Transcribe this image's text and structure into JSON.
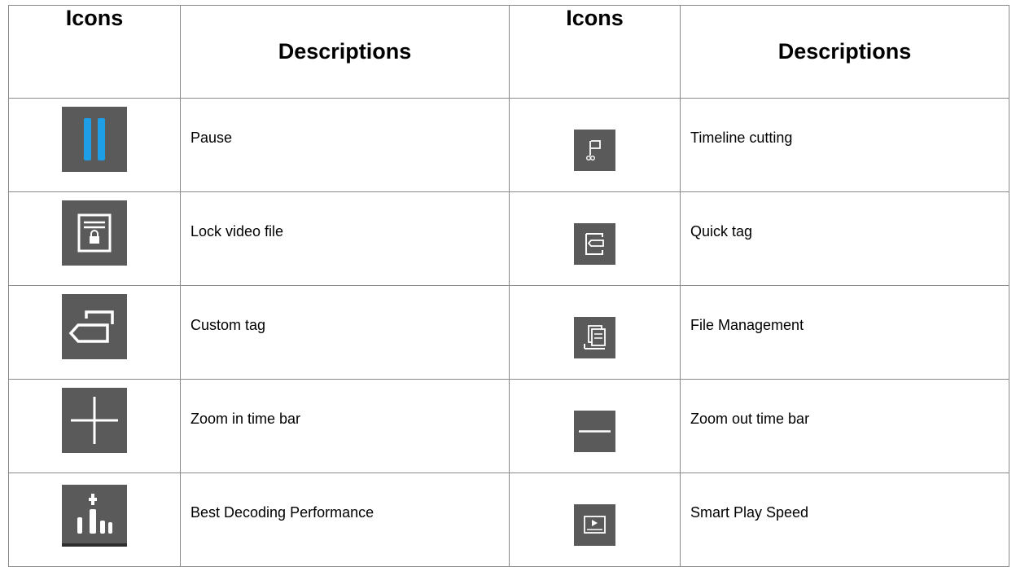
{
  "table": {
    "headers": [
      "Icons",
      "Descriptions",
      "Icons",
      "Descriptions"
    ],
    "rows": [
      {
        "left_icon": "pause-icon",
        "left_label": "Pause",
        "right_icon": "timeline-cutting-icon",
        "right_label": "Timeline cutting"
      },
      {
        "left_icon": "lock-video-file-icon",
        "left_label": "Lock video file",
        "right_icon": "quick-tag-icon",
        "right_label": "Quick tag"
      },
      {
        "left_icon": "custom-tag-icon",
        "left_label": "Custom tag",
        "right_icon": "file-management-icon",
        "right_label": "File Management"
      },
      {
        "left_icon": "zoom-in-icon",
        "left_label": "Zoom in time bar",
        "right_icon": "zoom-out-icon",
        "right_label": "Zoom out time bar"
      },
      {
        "left_icon": "best-decoding-performance-icon",
        "left_label": "Best Decoding Performance",
        "right_icon": "smart-play-speed-icon",
        "right_label": "Smart Play Speed"
      }
    ]
  },
  "colors": {
    "icon_background": "#5a5a5a",
    "pause_accent": "#1e9ee6",
    "icon_foreground": "#ffffff",
    "border": "#8a8a8a"
  }
}
